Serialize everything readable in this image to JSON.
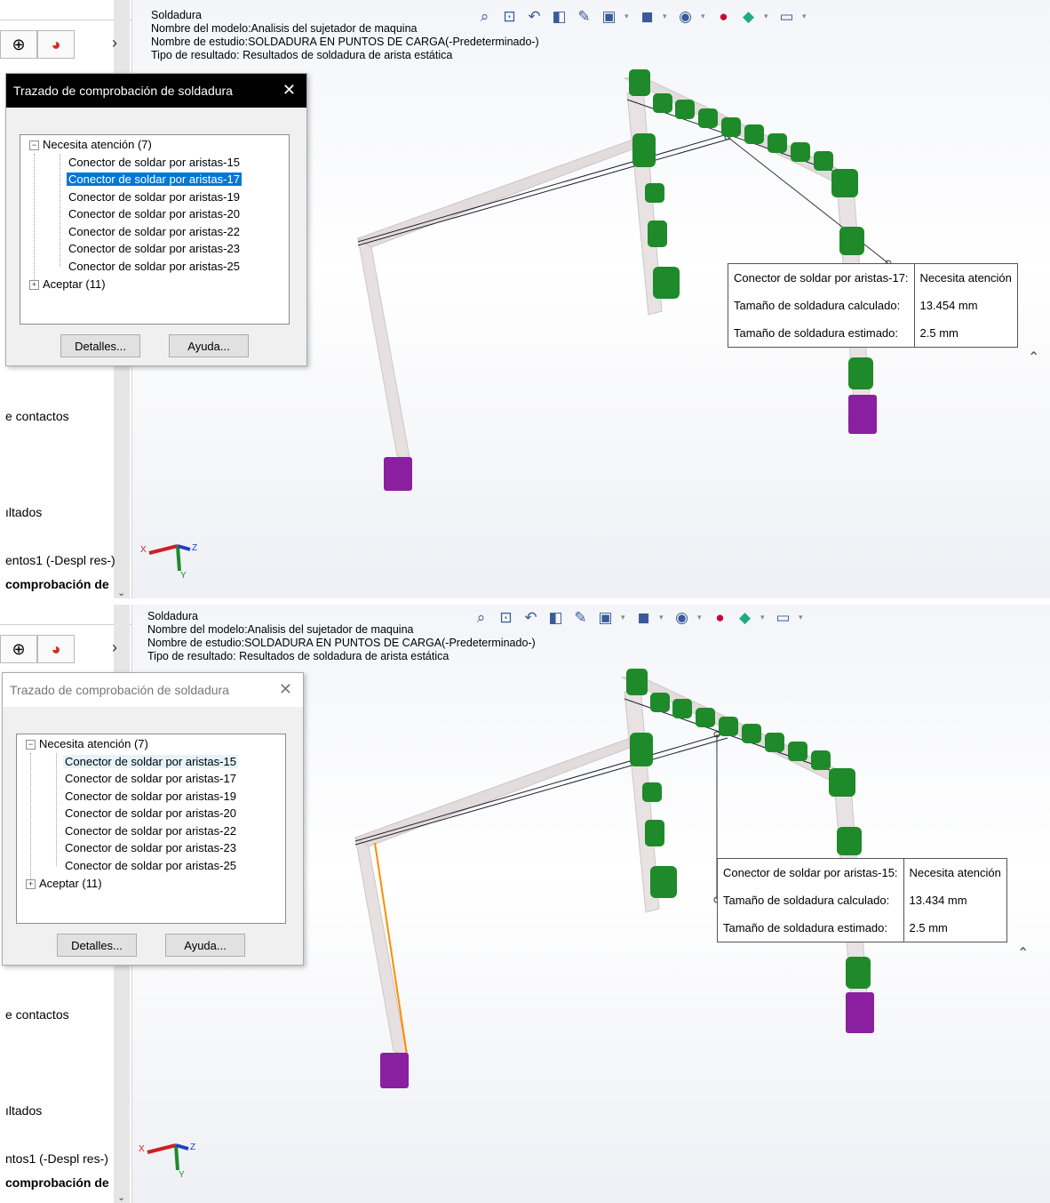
{
  "panels": [
    {
      "header": {
        "title": "Soldadura",
        "model": "Nombre del modelo:Analisis del sujetador de maquina",
        "study": "Nombre de estudio:SOLDADURA EN PUNTOS DE CARGA(-Predeterminado-)",
        "result_type": "Tipo de resultado: Resultados de soldadura de arista estática"
      },
      "sidebar": {
        "items": [
          "e contactos",
          "ıltados",
          "entos1 (-Despl res-)",
          "comprobación de"
        ]
      },
      "dialog": {
        "title": "Trazado de comprobación de soldadura",
        "close": "✕",
        "tree": {
          "group1": "Necesita atención (7)",
          "children": [
            "Conector de soldar por aristas-15",
            "Conector de soldar por aristas-17",
            "Conector de soldar por aristas-19",
            "Conector de soldar por aristas-20",
            "Conector de soldar por aristas-22",
            "Conector de soldar por aristas-23",
            "Conector de soldar por aristas-25"
          ],
          "group2": "Aceptar (11)"
        },
        "buttons": {
          "details": "Detalles...",
          "help": "Ayuda..."
        }
      },
      "callout": {
        "rows": [
          [
            "Conector de soldar por aristas-17:",
            "Necesita atención"
          ],
          [
            "Tamaño de soldadura calculado:",
            "13.454 mm"
          ],
          [
            "Tamaño de soldadura estimado:",
            "2.5 mm"
          ]
        ]
      }
    },
    {
      "header": {
        "title": "Soldadura",
        "model": "Nombre del modelo:Analisis del sujetador de maquina",
        "study": "Nombre de estudio:SOLDADURA EN PUNTOS DE CARGA(-Predeterminado-)",
        "result_type": "Tipo de resultado: Resultados de soldadura de arista estática"
      },
      "sidebar": {
        "items": [
          "e contactos",
          "ıltados",
          "ntos1 (-Despl res-)",
          "comprobación de"
        ]
      },
      "dialog": {
        "title": "Trazado de comprobación de soldadura",
        "close": "✕",
        "tree": {
          "group1": "Necesita atención (7)",
          "children": [
            "Conector de soldar por aristas-15",
            "Conector de soldar por aristas-17",
            "Conector de soldar por aristas-19",
            "Conector de soldar por aristas-20",
            "Conector de soldar por aristas-22",
            "Conector de soldar por aristas-23",
            "Conector de soldar por aristas-25"
          ],
          "group2": "Aceptar (11)"
        },
        "buttons": {
          "details": "Detalles...",
          "help": "Ayuda..."
        }
      },
      "callout": {
        "rows": [
          [
            "Conector de soldar por aristas-15:",
            "Necesita atención"
          ],
          [
            "Tamaño de soldadura calculado:",
            "13.434 mm"
          ],
          [
            "Tamaño de soldadura estimado:",
            "2.5 mm"
          ]
        ]
      }
    }
  ],
  "triad": {
    "x": "X",
    "y": "Y",
    "z": "Z"
  },
  "toolbar_icons": [
    "zoom-to-fit-icon",
    "zoom-area-icon",
    "previous-view-icon",
    "section-view-icon",
    "dynamic-annotation-icon",
    "view-orientation-icon",
    "display-style-icon",
    "hide-show-icon",
    "edit-appearance-icon",
    "apply-scene-icon",
    "view-settings-icon"
  ],
  "colors": {
    "selection": "#0078d7",
    "weld_symbol": "#1e8a2a",
    "fixture": "#8a1fa0",
    "highlight_edge": "#ff8c00",
    "beam": "#e2dcdc"
  }
}
